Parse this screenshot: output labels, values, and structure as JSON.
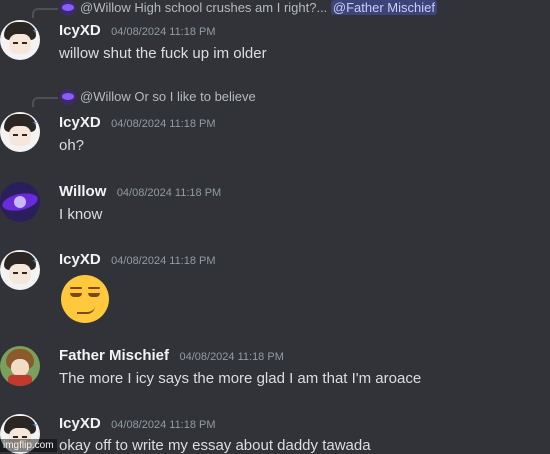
{
  "messages": [
    {
      "author": "IcyXD",
      "timestamp": "04/08/2024 11:18 PM",
      "text": "willow shut the fuck up im older",
      "reply": {
        "author": "@Willow",
        "text": "High school crushes am I right?...",
        "mention": "@Father Mischief"
      }
    },
    {
      "author": "IcyXD",
      "timestamp": "04/08/2024 11:18 PM",
      "text": "oh?",
      "reply": {
        "author": "@Willow",
        "text": "Or so I like to believe"
      }
    },
    {
      "author": "Willow",
      "timestamp": "04/08/2024 11:18 PM",
      "text": "I know"
    },
    {
      "author": "IcyXD",
      "timestamp": "04/08/2024 11:18 PM",
      "emoji": "smirk-emoji"
    },
    {
      "author": "Father Mischief",
      "timestamp": "04/08/2024 11:18 PM",
      "text": "The more I icy says the more glad I am that I'm aroace"
    },
    {
      "author": "IcyXD",
      "timestamp": "04/08/2024 11:18 PM",
      "text": "okay off to write my essay about daddy tawada"
    }
  ],
  "watermark": "imgflip.com",
  "colors": {
    "background": "#313338",
    "text": "#dbdee1",
    "muted": "#949ba4",
    "mention_bg": "#3c4270"
  }
}
